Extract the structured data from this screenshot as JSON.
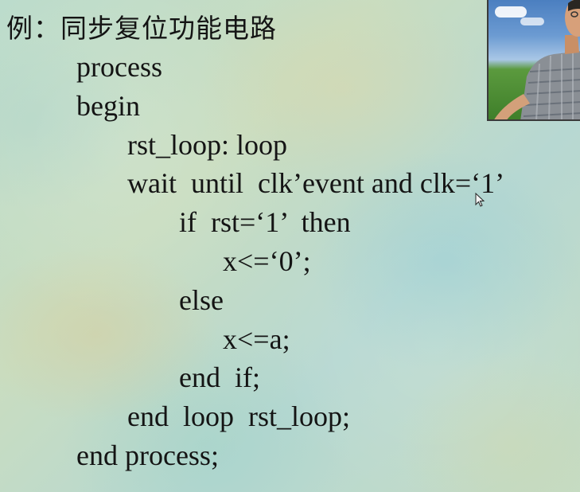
{
  "slide": {
    "title": "例：同步复位功能电路",
    "code": {
      "line1": "process",
      "line2": "begin",
      "line3": "rst_loop: loop",
      "line4": "wait  until  clk’event and clk=‘1’",
      "line5": "if  rst=‘1’  then",
      "line6": "x<=‘0’;",
      "line7": "else",
      "line8": "x<=a;",
      "line9": "end  if;",
      "line10": "end  loop  rst_loop;",
      "line11": "end process;"
    }
  },
  "video_overlay": {
    "icon": "presenter-video-icon"
  },
  "pointer": {
    "icon": "mouse-cursor-icon"
  }
}
